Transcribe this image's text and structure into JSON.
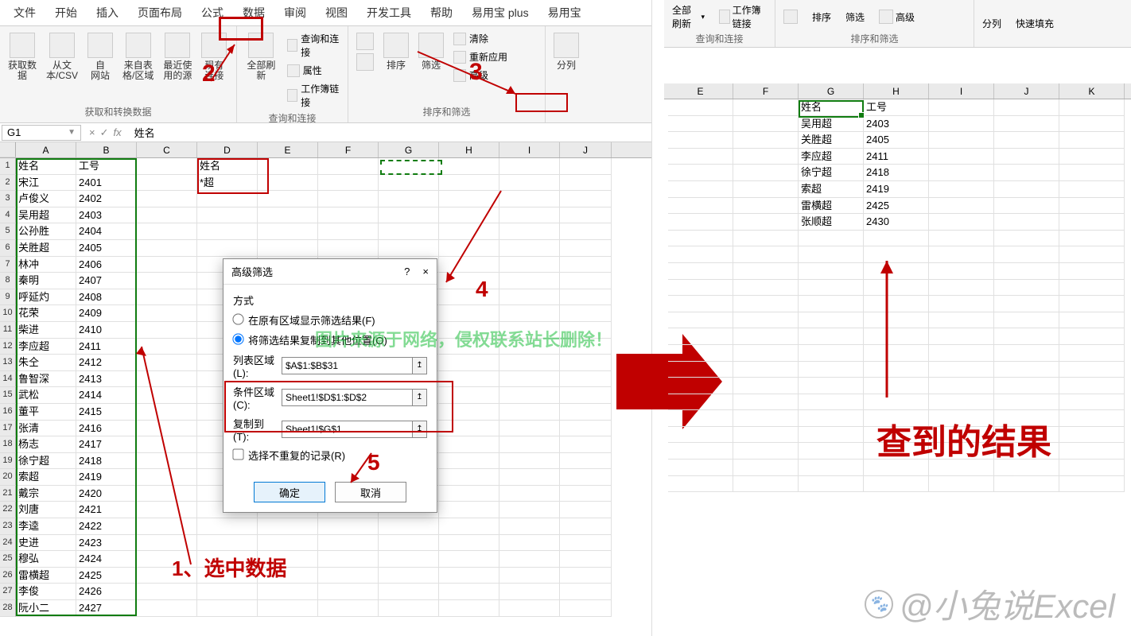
{
  "tabs": [
    "文件",
    "开始",
    "插入",
    "页面布局",
    "公式",
    "数据",
    "审阅",
    "视图",
    "开发工具",
    "帮助",
    "易用宝 plus",
    "易用宝"
  ],
  "active_tab_index": 5,
  "ribbon": {
    "group1": {
      "title": "获取和转换数据",
      "btns": [
        "获取数\n据",
        "从文\n本/CSV",
        "自\n网站",
        "来自表\n格/区域",
        "最近使\n用的源",
        "现有\n连接"
      ]
    },
    "group2": {
      "title": "查询和连接",
      "big": "全部刷新",
      "minis": [
        "查询和连接",
        "属性",
        "工作簿链接"
      ]
    },
    "group3": {
      "title": "排序和筛选",
      "sort_btns": [
        "A↓Z",
        "Z↓A"
      ],
      "sort_label": "排序",
      "filter_label": "筛选",
      "minis": [
        "清除",
        "重新应用",
        "高级"
      ]
    },
    "group4": {
      "btn": "分列"
    }
  },
  "name_box": "G1",
  "formula_value": "姓名",
  "left_headers": [
    "A",
    "B",
    "C",
    "D",
    "E",
    "F",
    "G",
    "H",
    "I",
    "J"
  ],
  "criteria": {
    "header": "姓名",
    "pattern": "*超"
  },
  "main_data": [
    [
      "姓名",
      "工号"
    ],
    [
      "宋江",
      "2401"
    ],
    [
      "卢俊义",
      "2402"
    ],
    [
      "吴用超",
      "2403"
    ],
    [
      "公孙胜",
      "2404"
    ],
    [
      "关胜超",
      "2405"
    ],
    [
      "林冲",
      "2406"
    ],
    [
      "秦明",
      "2407"
    ],
    [
      "呼延灼",
      "2408"
    ],
    [
      "花荣",
      "2409"
    ],
    [
      "柴进",
      "2410"
    ],
    [
      "李应超",
      "2411"
    ],
    [
      "朱仝",
      "2412"
    ],
    [
      "鲁智深",
      "2413"
    ],
    [
      "武松",
      "2414"
    ],
    [
      "董平",
      "2415"
    ],
    [
      "张清",
      "2416"
    ],
    [
      "杨志",
      "2417"
    ],
    [
      "徐宁超",
      "2418"
    ],
    [
      "索超",
      "2419"
    ],
    [
      "戴宗",
      "2420"
    ],
    [
      "刘唐",
      "2421"
    ],
    [
      "李逵",
      "2422"
    ],
    [
      "史进",
      "2423"
    ],
    [
      "穆弘",
      "2424"
    ],
    [
      "雷横超",
      "2425"
    ],
    [
      "李俊",
      "2426"
    ],
    [
      "阮小二",
      "2427"
    ]
  ],
  "dialog": {
    "title": "高级筛选",
    "help": "?",
    "close": "×",
    "section": "方式",
    "opt1": "在原有区域显示筛选结果(F)",
    "opt2": "将筛选结果复制到其他位置(O)",
    "list_label": "列表区域(L):",
    "list_val": "$A$1:$B$31",
    "crit_label": "条件区域(C):",
    "crit_val": "Sheet1!$D$1:$D$2",
    "copy_label": "复制到(T):",
    "copy_val": "Sheet1!$G$1",
    "unique": "选择不重复的记录(R)",
    "ok": "确定",
    "cancel": "取消"
  },
  "right_ribbon": {
    "refresh": "全部刷新",
    "wb_links": "工作簿链接",
    "group1": "查询和连接",
    "sort": "排序",
    "filter": "筛选",
    "adv": "高级",
    "group2": "排序和筛选",
    "split": "分列",
    "fill": "快速填充"
  },
  "right_headers": [
    "E",
    "F",
    "G",
    "H",
    "I",
    "J",
    "K"
  ],
  "results": [
    [
      "姓名",
      "工号"
    ],
    [
      "吴用超",
      "2403"
    ],
    [
      "关胜超",
      "2405"
    ],
    [
      "李应超",
      "2411"
    ],
    [
      "徐宁超",
      "2418"
    ],
    [
      "索超",
      "2419"
    ],
    [
      "雷横超",
      "2425"
    ],
    [
      "张顺超",
      "2430"
    ]
  ],
  "annotations": {
    "a1": "1、选中数据",
    "a2": "2",
    "a3": "3",
    "a4": "4",
    "a5": "5",
    "result_title": "查到的结果"
  },
  "watermark": "@小兔说Excel",
  "green_wm": "图片来源于网络，侵权联系站长删除！"
}
